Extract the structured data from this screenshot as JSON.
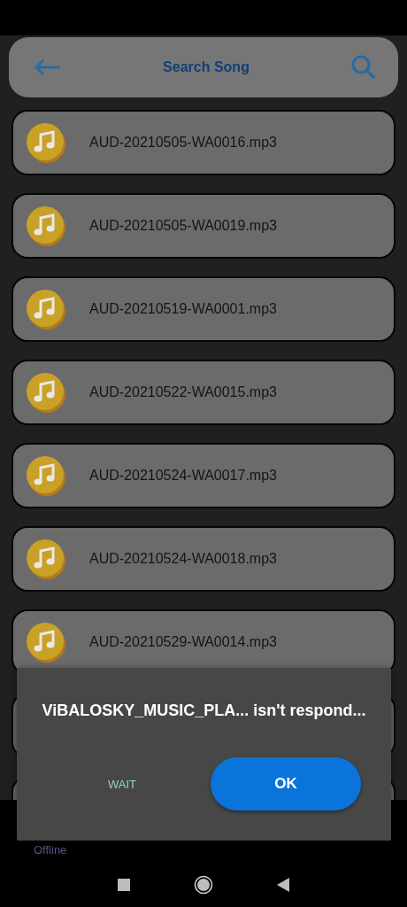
{
  "header": {
    "title": "Search Song"
  },
  "songs": [
    {
      "name": "AUD-20210505-WA0016.mp3"
    },
    {
      "name": "AUD-20210505-WA0019.mp3"
    },
    {
      "name": "AUD-20210519-WA0001.mp3"
    },
    {
      "name": "AUD-20210522-WA0015.mp3"
    },
    {
      "name": "AUD-20210524-WA0017.mp3"
    },
    {
      "name": "AUD-20210524-WA0018.mp3"
    },
    {
      "name": "AUD-20210529-WA0014.mp3"
    }
  ],
  "footer": {
    "status": "Offline"
  },
  "dialog": {
    "message": "ViBALOSKY_MUSIC_PLA... isn't respond...",
    "buttons": [
      {
        "label": "WAIT",
        "kind": "text"
      },
      {
        "label": "OK",
        "kind": "filled"
      }
    ]
  }
}
